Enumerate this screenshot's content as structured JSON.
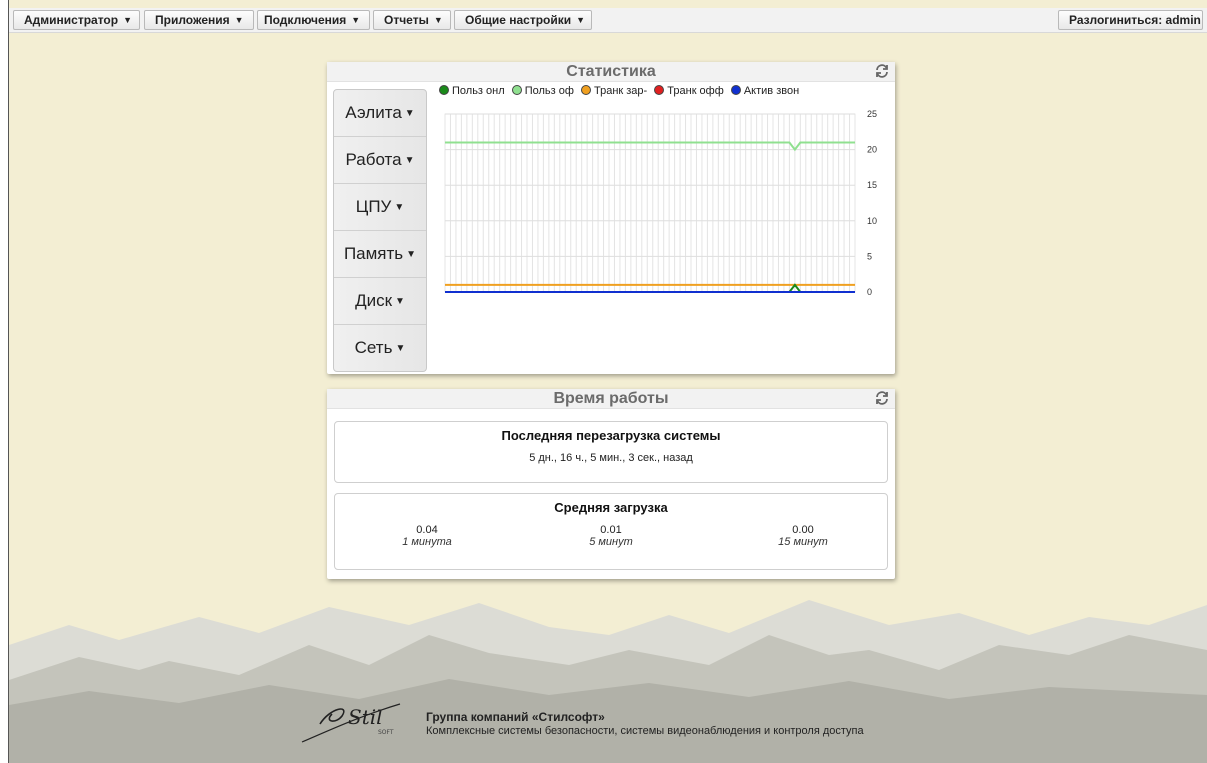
{
  "menubar": {
    "items": [
      "Администратор",
      "Приложения",
      "Подключения",
      "Отчеты",
      "Общие настройки"
    ],
    "logout": "Разлогиниться: admin"
  },
  "stats_panel": {
    "title": "Статистика",
    "menu": [
      "Аэлита",
      "Работа",
      "ЦПУ",
      "Память",
      "Диск",
      "Сеть"
    ]
  },
  "chart_data": {
    "type": "line",
    "ylim": [
      0,
      25
    ],
    "yticks": [
      "25",
      "20",
      "15",
      "10",
      "5",
      "0"
    ],
    "y_axis_side": "right",
    "grid": true,
    "legend": "top",
    "series": [
      {
        "name": "Польз онл",
        "color": "#1a8a1a",
        "values": [
          0,
          0,
          0,
          0,
          0,
          0,
          0,
          0,
          0,
          0,
          0,
          0,
          0,
          0,
          0,
          0,
          0,
          0,
          0,
          0,
          0,
          0,
          0,
          0,
          0,
          0,
          0,
          0,
          0,
          0,
          0,
          0,
          0,
          0,
          0,
          0,
          0,
          0,
          0,
          0,
          0,
          0,
          0,
          0,
          0,
          0,
          0,
          0,
          0,
          0,
          0,
          0,
          0,
          0,
          0,
          0,
          0,
          0,
          0,
          0,
          0,
          0,
          0,
          0,
          1,
          0,
          0,
          0,
          0,
          0,
          0,
          0,
          0,
          0,
          0,
          0
        ]
      },
      {
        "name": "Польз оф",
        "color": "#90e090",
        "values": [
          21,
          21,
          21,
          21,
          21,
          21,
          21,
          21,
          21,
          21,
          21,
          21,
          21,
          21,
          21,
          21,
          21,
          21,
          21,
          21,
          21,
          21,
          21,
          21,
          21,
          21,
          21,
          21,
          21,
          21,
          21,
          21,
          21,
          21,
          21,
          21,
          21,
          21,
          21,
          21,
          21,
          21,
          21,
          21,
          21,
          21,
          21,
          21,
          21,
          21,
          21,
          21,
          21,
          21,
          21,
          21,
          21,
          21,
          21,
          21,
          21,
          21,
          21,
          21,
          20,
          21,
          21,
          21,
          21,
          21,
          21,
          21,
          21,
          21,
          21,
          21
        ]
      },
      {
        "name": "Транк зар-",
        "color": "#f0a020",
        "values": [
          1,
          1,
          1,
          1,
          1,
          1,
          1,
          1,
          1,
          1,
          1,
          1,
          1,
          1,
          1,
          1,
          1,
          1,
          1,
          1,
          1,
          1,
          1,
          1,
          1,
          1,
          1,
          1,
          1,
          1,
          1,
          1,
          1,
          1,
          1,
          1,
          1,
          1,
          1,
          1,
          1,
          1,
          1,
          1,
          1,
          1,
          1,
          1,
          1,
          1,
          1,
          1,
          1,
          1,
          1,
          1,
          1,
          1,
          1,
          1,
          1,
          1,
          1,
          1,
          1,
          1,
          1,
          1,
          1,
          1,
          1,
          1,
          1,
          1,
          1,
          1
        ]
      },
      {
        "name": "Транк офф",
        "color": "#e02020",
        "values": [
          0,
          0,
          0,
          0,
          0,
          0,
          0,
          0,
          0,
          0,
          0,
          0,
          0,
          0,
          0,
          0,
          0,
          0,
          0,
          0,
          0,
          0,
          0,
          0,
          0,
          0,
          0,
          0,
          0,
          0,
          0,
          0,
          0,
          0,
          0,
          0,
          0,
          0,
          0,
          0,
          0,
          0,
          0,
          0,
          0,
          0,
          0,
          0,
          0,
          0,
          0,
          0,
          0,
          0,
          0,
          0,
          0,
          0,
          0,
          0,
          0,
          0,
          0,
          0,
          0,
          0,
          0,
          0,
          0,
          0,
          0,
          0,
          0,
          0,
          0,
          0
        ]
      },
      {
        "name": "Актив звон",
        "color": "#1030d0",
        "values": [
          0,
          0,
          0,
          0,
          0,
          0,
          0,
          0,
          0,
          0,
          0,
          0,
          0,
          0,
          0,
          0,
          0,
          0,
          0,
          0,
          0,
          0,
          0,
          0,
          0,
          0,
          0,
          0,
          0,
          0,
          0,
          0,
          0,
          0,
          0,
          0,
          0,
          0,
          0,
          0,
          0,
          0,
          0,
          0,
          0,
          0,
          0,
          0,
          0,
          0,
          0,
          0,
          0,
          0,
          0,
          0,
          0,
          0,
          0,
          0,
          0,
          0,
          0,
          0,
          0,
          0,
          0,
          0,
          0,
          0,
          0,
          0,
          0,
          0,
          0,
          0
        ]
      }
    ]
  },
  "uptime_panel": {
    "title": "Время работы",
    "reboot_title": "Последняя перезагрузка системы",
    "reboot_value": "5 дн., 16 ч., 5 мин., 3 сек., назад",
    "load_title": "Средняя загрузка",
    "loads": [
      {
        "value": "0.04",
        "label": "1 минута"
      },
      {
        "value": "0.01",
        "label": "5 минут"
      },
      {
        "value": "0.00",
        "label": "15 минут"
      }
    ]
  },
  "footer": {
    "title": "Группа компаний «Стилсофт»",
    "subtitle": "Комплексные системы безопасности, системы видеонаблюдения и контроля доступа",
    "logo_text": "Stil",
    "logo_sub": "SOFT"
  },
  "colors": {
    "background": "#f3eed3",
    "mountain_light": "#d9d9d2",
    "mountain_dark": "#a7a79e"
  },
  "icons": {
    "refresh": "refresh-icon",
    "caret": "caret-down-icon"
  }
}
